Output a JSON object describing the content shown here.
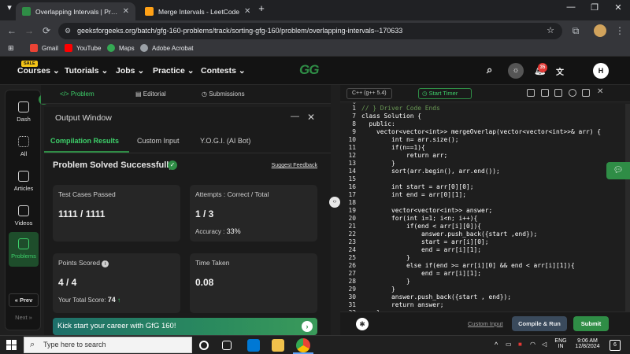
{
  "browser": {
    "tabs": [
      {
        "title": "Overlapping Intervals | Practice",
        "active": true,
        "favicon_color": "#2f8d46"
      },
      {
        "title": "Merge Intervals - LeetCode",
        "active": false,
        "favicon_color": "#ffa116"
      }
    ],
    "new_tab": "+",
    "url": "geeksforgeeks.org/batch/gfg-160-problems/track/sorting-gfg-160/problem/overlapping-intervals--170633",
    "bookmarks": [
      {
        "label": "Gmail",
        "color": "#ea4335"
      },
      {
        "label": "YouTube",
        "color": "#ff0000"
      },
      {
        "label": "Maps",
        "color": "#34a853"
      },
      {
        "label": "Adobe Acrobat",
        "color": "#9aa0a6"
      }
    ]
  },
  "site": {
    "logo": "GG",
    "sale_badge": "SALE",
    "nav": [
      "Courses",
      "Tutorials",
      "Jobs",
      "Practice",
      "Contests"
    ],
    "notification_count": "35",
    "avatar_letter": "H"
  },
  "rail": {
    "items": [
      "Dash",
      "All",
      "Articles",
      "Videos",
      "Problems"
    ],
    "prev": "« Prev",
    "next": "Next »"
  },
  "problem_tabs": [
    "Problem",
    "Editorial",
    "Submissions"
  ],
  "output": {
    "title": "Output Window",
    "tabs": [
      "Compilation Results",
      "Custom Input",
      "Y.O.G.I. (AI Bot)"
    ],
    "status": "Problem Solved Successfully",
    "feedback": "Suggest Feedback",
    "test_cases_label": "Test Cases Passed",
    "test_cases_value": "1111 / 1111",
    "attempts_label": "Attempts : Correct / Total",
    "attempts_value": "1 / 3",
    "accuracy_label": "Accuracy :",
    "accuracy_value": "33%",
    "points_label": "Points Scored",
    "points_value": "4 / 4",
    "total_score_label": "Your Total Score:",
    "total_score_value": "74",
    "time_label": "Time Taken",
    "time_value": "0.08",
    "banner": "Kick start your career with GfG 160!"
  },
  "editor": {
    "language": "C++ (g++ 5.4)",
    "timer": "Start Timer",
    "lines": [
      {
        "n": "1",
        "t": "// } Driver Code Ends"
      },
      {
        "n": "7",
        "t": "class Solution {"
      },
      {
        "n": "8",
        "t": "  public:"
      },
      {
        "n": "9",
        "t": "    vector<vector<int>> mergeOverlap(vector<vector<int>>& arr) {"
      },
      {
        "n": "10",
        "t": "        int n= arr.size();"
      },
      {
        "n": "11",
        "t": "        if(n==1){"
      },
      {
        "n": "12",
        "t": "            return arr;"
      },
      {
        "n": "13",
        "t": "        }"
      },
      {
        "n": "14",
        "t": "        sort(arr.begin(), arr.end());"
      },
      {
        "n": "15",
        "t": ""
      },
      {
        "n": "16",
        "t": "        int start = arr[0][0];"
      },
      {
        "n": "17",
        "t": "        int end = arr[0][1];"
      },
      {
        "n": "18",
        "t": ""
      },
      {
        "n": "19",
        "t": "        vector<vector<int>> answer;"
      },
      {
        "n": "20",
        "t": "        for(int i=1; i<n; i++){"
      },
      {
        "n": "21",
        "t": "            if(end < arr[i][0]){"
      },
      {
        "n": "22",
        "t": "                answer.push_back({start ,end});"
      },
      {
        "n": "23",
        "t": "                start = arr[i][0];"
      },
      {
        "n": "24",
        "t": "                end = arr[i][1];"
      },
      {
        "n": "25",
        "t": "            }"
      },
      {
        "n": "26",
        "t": "            else if(end >= arr[i][0] && end < arr[i][1]){"
      },
      {
        "n": "27",
        "t": "                end = arr[i][1];"
      },
      {
        "n": "28",
        "t": "            }"
      },
      {
        "n": "29",
        "t": "        }"
      },
      {
        "n": "30",
        "t": "        answer.push_back({start , end});"
      },
      {
        "n": "31",
        "t": "        return answer;"
      },
      {
        "n": "32",
        "t": "    }"
      }
    ],
    "custom_input": "Custom Input",
    "compile": "Compile & Run",
    "submit": "Submit"
  },
  "taskbar": {
    "search_placeholder": "Type here to search",
    "lang_top": "ENG",
    "lang_bottom": "IN",
    "time": "9:06 AM",
    "date": "12/8/2024",
    "notif": "6"
  }
}
